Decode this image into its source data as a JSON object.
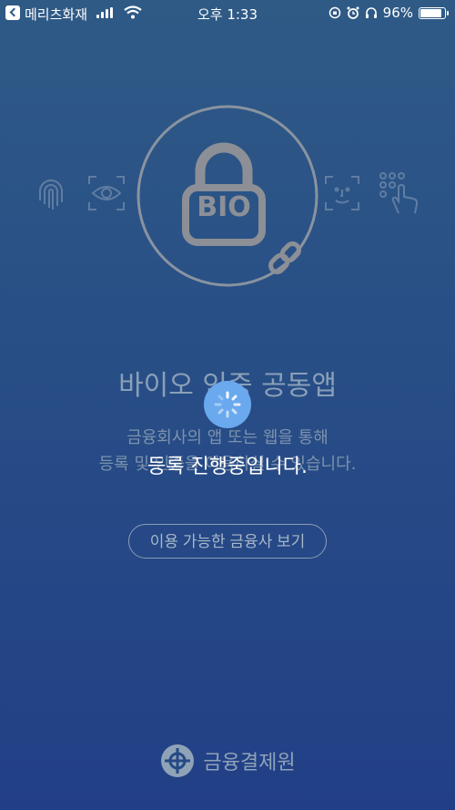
{
  "status_bar": {
    "carrier": "메리츠화재",
    "time": "오후 1:33",
    "battery_percent": "96%",
    "battery_level": 0.96
  },
  "hero": {
    "lock_text": "BIO"
  },
  "main": {
    "title": "바이오 인증 공동앱",
    "description_line1": "금융회사의 앱 또는 웹을 통해",
    "description_line2": "등록 및 인증을 이용하실 수 있습니다.",
    "loading_text": "등록 진행중입니다.",
    "button_label": "이용 가능한 금융사 보기"
  },
  "footer": {
    "logo_text": "금융결제원"
  },
  "colors": {
    "background_top": "#2f5a86",
    "background_bottom": "#223f86",
    "spinner": "#6aa9ee"
  }
}
